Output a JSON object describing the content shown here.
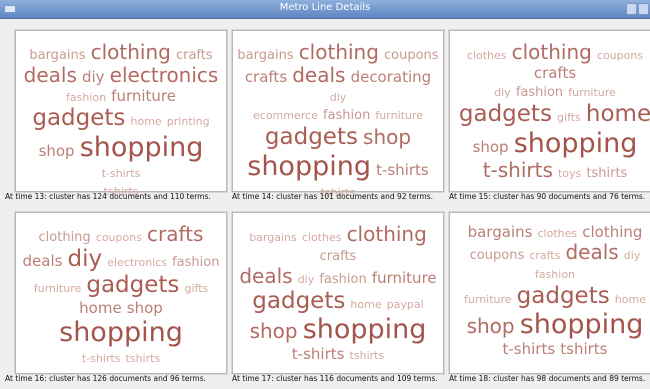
{
  "window": {
    "title": "Metro Line Details"
  },
  "panels": [
    {
      "caption": "At time 13: cluster has 124 documents and 110 terms.",
      "lines": [
        [
          {
            "t": "bargains",
            "s": 2
          },
          {
            "t": "clothing",
            "s": 4
          },
          {
            "t": "crafts",
            "s": 2
          }
        ],
        [
          {
            "t": "deals",
            "s": 4
          },
          {
            "t": "diy",
            "s": 3
          },
          {
            "t": "electronics",
            "s": 4
          }
        ],
        [
          {
            "t": "fashion",
            "s": 1
          },
          {
            "t": "furniture",
            "s": 3
          }
        ],
        [
          {
            "t": "gadgets",
            "s": 5
          },
          {
            "t": "home",
            "s": 1
          },
          {
            "t": "printing",
            "s": 1
          }
        ],
        [
          {
            "t": "shop",
            "s": 3
          },
          {
            "t": "shopping",
            "s": 6
          },
          {
            "t": "t-shirts",
            "s": 1
          }
        ],
        [
          {
            "t": "tshirts",
            "s": 1
          }
        ]
      ]
    },
    {
      "caption": "At time 14: cluster has 101 documents and 92 terms.",
      "lines": [
        [
          {
            "t": "bargains",
            "s": 2
          },
          {
            "t": "clothing",
            "s": 4
          },
          {
            "t": "coupons",
            "s": 2
          }
        ],
        [
          {
            "t": "crafts",
            "s": 3
          },
          {
            "t": "deals",
            "s": 4
          },
          {
            "t": "decorating",
            "s": 3
          },
          {
            "t": "diy",
            "s": 1
          }
        ],
        [
          {
            "t": "ecommerce",
            "s": 1
          },
          {
            "t": "fashion",
            "s": 2
          },
          {
            "t": "furniture",
            "s": 1
          }
        ],
        [
          {
            "t": "gadgets",
            "s": 5
          },
          {
            "t": "shop",
            "s": 4
          }
        ],
        [
          {
            "t": "shopping",
            "s": 6
          },
          {
            "t": "t-shirts",
            "s": 3
          }
        ],
        [
          {
            "t": "tshirts",
            "s": 1
          }
        ]
      ]
    },
    {
      "caption": "At time 15: cluster has 90 documents and 76 terms.",
      "lines": [
        [
          {
            "t": "clothes",
            "s": 1
          },
          {
            "t": "clothing",
            "s": 4
          },
          {
            "t": "coupons",
            "s": 1
          },
          {
            "t": "crafts",
            "s": 3
          }
        ],
        [
          {
            "t": "diy",
            "s": 1
          },
          {
            "t": "fashion",
            "s": 2
          },
          {
            "t": "furniture",
            "s": 1
          }
        ],
        [
          {
            "t": "gadgets",
            "s": 5
          },
          {
            "t": "gifts",
            "s": 1
          },
          {
            "t": "home",
            "s": 5
          }
        ],
        [
          {
            "t": "shop",
            "s": 3
          },
          {
            "t": "shopping",
            "s": 6
          }
        ],
        [
          {
            "t": "t-shirts",
            "s": 4
          },
          {
            "t": "toys",
            "s": 1
          },
          {
            "t": "tshirts",
            "s": 2
          }
        ]
      ]
    },
    {
      "caption": "At time 16: cluster has 126 documents and 96 terms.",
      "lines": [
        [
          {
            "t": "clothing",
            "s": 2
          },
          {
            "t": "coupons",
            "s": 1
          },
          {
            "t": "crafts",
            "s": 4
          }
        ],
        [
          {
            "t": "deals",
            "s": 3
          },
          {
            "t": "diy",
            "s": 5
          },
          {
            "t": "electronics",
            "s": 1
          },
          {
            "t": "fashion",
            "s": 2
          }
        ],
        [
          {
            "t": "furniture",
            "s": 1
          },
          {
            "t": "gadgets",
            "s": 5
          },
          {
            "t": "gifts",
            "s": 1
          }
        ],
        [
          {
            "t": "home",
            "s": 3
          },
          {
            "t": "shop",
            "s": 3
          },
          {
            "t": "shopping",
            "s": 6
          }
        ],
        [
          {
            "t": "t-shirts",
            "s": 1
          },
          {
            "t": "tshirts",
            "s": 1
          }
        ]
      ]
    },
    {
      "caption": "At time 17: cluster has 116 documents and 109 terms.",
      "lines": [
        [
          {
            "t": "bargains",
            "s": 1
          },
          {
            "t": "clothes",
            "s": 1
          },
          {
            "t": "clothing",
            "s": 4
          },
          {
            "t": "crafts",
            "s": 2
          }
        ],
        [
          {
            "t": "deals",
            "s": 4
          },
          {
            "t": "diy",
            "s": 1
          },
          {
            "t": "fashion",
            "s": 2
          },
          {
            "t": "furniture",
            "s": 3
          }
        ],
        [
          {
            "t": "gadgets",
            "s": 5
          },
          {
            "t": "home",
            "s": 1
          },
          {
            "t": "paypal",
            "s": 1
          }
        ],
        [
          {
            "t": "shop",
            "s": 4
          },
          {
            "t": "shopping",
            "s": 6
          }
        ],
        [
          {
            "t": "t-shirts",
            "s": 3
          },
          {
            "t": "tshirts",
            "s": 1
          }
        ]
      ]
    },
    {
      "caption": "At time 18: cluster has 98 documents and 89 terms.",
      "lines": [
        [
          {
            "t": "bargains",
            "s": 3
          },
          {
            "t": "clothes",
            "s": 1
          },
          {
            "t": "clothing",
            "s": 3
          }
        ],
        [
          {
            "t": "coupons",
            "s": 2
          },
          {
            "t": "crafts",
            "s": 1
          },
          {
            "t": "deals",
            "s": 4
          },
          {
            "t": "diy",
            "s": 1
          },
          {
            "t": "fashion",
            "s": 1
          }
        ],
        [
          {
            "t": "furniture",
            "s": 1
          },
          {
            "t": "gadgets",
            "s": 5
          },
          {
            "t": "home",
            "s": 1
          }
        ],
        [
          {
            "t": "shop",
            "s": 4
          },
          {
            "t": "shopping",
            "s": 6
          }
        ],
        [
          {
            "t": "t-shirts",
            "s": 3
          },
          {
            "t": "tshirts",
            "s": 3
          }
        ]
      ]
    }
  ]
}
